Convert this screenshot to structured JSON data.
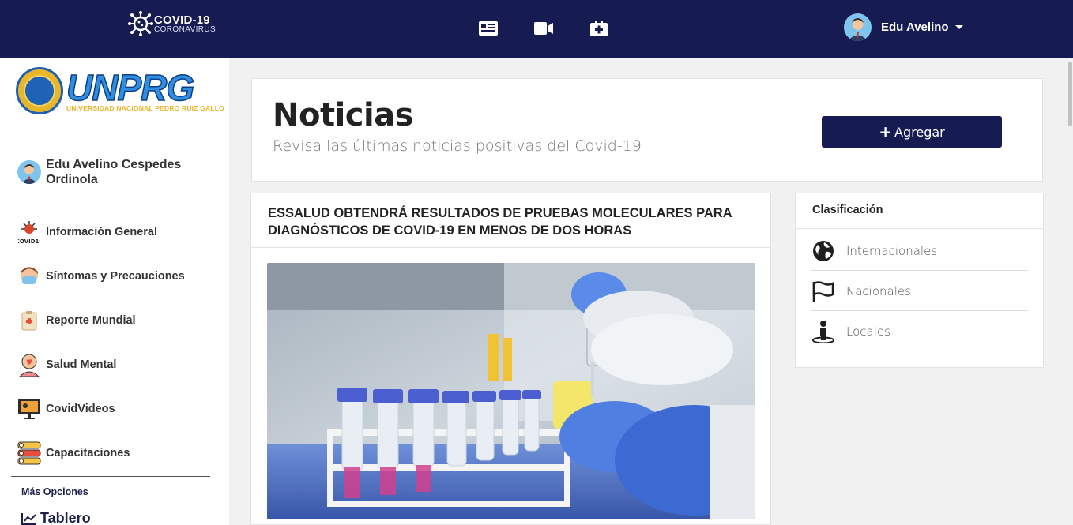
{
  "topbar": {
    "brand_title": "COVID-19",
    "brand_sub": "CORONAVIRUS",
    "nav_icons": [
      "newspaper-icon",
      "video-camera-icon",
      "medkit-icon"
    ],
    "user_name": "Edu Avelino"
  },
  "sidebar": {
    "logo_text": "UNPRG",
    "logo_subtext": "UNIVERSIDAD NACIONAL PEDRO RUIZ GALLO",
    "profile_name": "Edu Avelino Cespedes Ordinola",
    "items": [
      {
        "label": "Información General",
        "icon": "covid19-icon"
      },
      {
        "label": "Síntomas y Precauciones",
        "icon": "masked-person-icon"
      },
      {
        "label": "Reporte Mundial",
        "icon": "clipboard-report-icon"
      },
      {
        "label": "Salud Mental",
        "icon": "mental-health-icon"
      },
      {
        "label": "CovidVideos",
        "icon": "video-screen-icon"
      },
      {
        "label": "Capacitaciones",
        "icon": "training-list-icon"
      }
    ],
    "more_label": "Más Opciones",
    "tablero_label": "Tablero"
  },
  "header": {
    "title": "Noticias",
    "subtitle": "Revisa las últimas noticias positivas del Covid-19",
    "add_button": "Agregar"
  },
  "news": {
    "title": "ESSALUD OBTENDRÁ RESULTADOS DE PRUEBAS MOLECULARES PARA DIAGNÓSTICOS DE COVID-19 EN MENOS DE DOS HORAS"
  },
  "classification": {
    "title": "Clasificación",
    "items": [
      {
        "label": "Internacionales",
        "icon": "globe-icon"
      },
      {
        "label": "Nacionales",
        "icon": "flag-icon"
      },
      {
        "label": "Locales",
        "icon": "person-location-icon"
      }
    ]
  },
  "colors": {
    "navy": "#161c52",
    "accent_blue": "#2f8ee0"
  }
}
